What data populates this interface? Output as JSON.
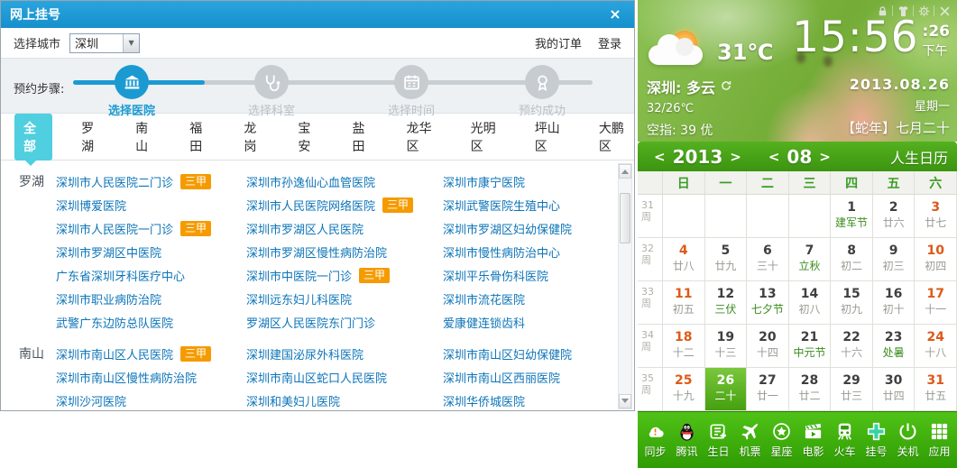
{
  "colors": {
    "titlebar_blue": "#1d9bd7",
    "accent_blue": "#1b9ad2",
    "tab_active_cyan": "#4fcfdf",
    "link_blue": "#0c74b8",
    "badge_orange": "#f59b00",
    "calendar_green": "#3f9e12",
    "weekend_orange": "#dd5a17",
    "toolbar_green": "#3bad0b"
  },
  "window": {
    "title": "网上挂号",
    "close_glyph": "×",
    "city_label": "选择城市",
    "city_value": "深圳",
    "my_orders": "我的订单",
    "login": "登录",
    "steps_label": "预约步骤:",
    "steps": [
      {
        "label": "选择医院",
        "icon": "hospital-building-icon",
        "active": true
      },
      {
        "label": "选择科室",
        "icon": "stethoscope-icon",
        "active": false
      },
      {
        "label": "选择时间",
        "icon": "calendar-icon",
        "active": false
      },
      {
        "label": "预约成功",
        "icon": "award-ribbon-icon",
        "active": false
      }
    ],
    "tabs": [
      "全部",
      "罗湖",
      "南山",
      "福田",
      "龙岗",
      "宝安",
      "盐田",
      "龙华区",
      "光明区",
      "坪山区",
      "大鹏区"
    ],
    "active_tab": "全部",
    "grade_badge": "三甲",
    "groups": [
      {
        "name": "罗湖",
        "columns": [
          [
            {
              "name": "深圳市人民医院二门诊",
              "grade": true
            },
            {
              "name": "深圳博爱医院"
            },
            {
              "name": "深圳市人民医院一门诊",
              "grade": true
            },
            {
              "name": "深圳市罗湖区中医院"
            },
            {
              "name": "广东省深圳牙科医疗中心"
            },
            {
              "name": "深圳市职业病防治院"
            },
            {
              "name": "武警广东边防总队医院"
            }
          ],
          [
            {
              "name": "深圳市孙逸仙心血管医院"
            },
            {
              "name": "深圳市人民医院网络医院",
              "grade": true
            },
            {
              "name": "深圳市罗湖区人民医院"
            },
            {
              "name": "深圳市罗湖区慢性病防治院"
            },
            {
              "name": "深圳市中医院一门诊",
              "grade": true
            },
            {
              "name": "深圳远东妇儿科医院"
            },
            {
              "name": "罗湖区人民医院东门门诊"
            }
          ],
          [
            {
              "name": "深圳市康宁医院"
            },
            {
              "name": "深圳武警医院生殖中心"
            },
            {
              "name": "深圳市罗湖区妇幼保健院"
            },
            {
              "name": "深圳市慢性病防治中心"
            },
            {
              "name": "深圳平乐骨伤科医院"
            },
            {
              "name": "深圳市流花医院"
            },
            {
              "name": "爱康健连锁齿科"
            }
          ]
        ]
      },
      {
        "name": "南山",
        "columns": [
          [
            {
              "name": "深圳市南山区人民医院",
              "grade": true
            },
            {
              "name": "深圳市南山区慢性病防治院"
            },
            {
              "name": "深圳沙河医院"
            }
          ],
          [
            {
              "name": "深圳建国泌尿外科医院"
            },
            {
              "name": "深圳市南山区蛇口人民医院"
            },
            {
              "name": "深圳和美妇儿医院"
            }
          ],
          [
            {
              "name": "深圳市南山区妇幼保健院"
            },
            {
              "name": "深圳市南山区西丽医院"
            },
            {
              "name": "深圳华侨城医院"
            }
          ]
        ]
      }
    ]
  },
  "widget": {
    "window_icons": [
      "lock-icon",
      "skin-shirt-icon",
      "gear-icon",
      "close-icon"
    ],
    "weather": {
      "temp": "31℃",
      "city_line": "深圳: 多云",
      "range": "32/26℃",
      "air": "空指: 39 优"
    },
    "time": {
      "hm": "15:56",
      "sec": ":26",
      "ampm": "下午"
    },
    "date": {
      "date": "2013.08.26",
      "weekday": "星期一",
      "lunar": "【蛇年】七月二十"
    },
    "cal": {
      "prev": "<",
      "next": ">",
      "year": "2013",
      "month": "08",
      "brand": "人生日历",
      "weekdays": [
        "日",
        "一",
        "二",
        "三",
        "四",
        "五",
        "六"
      ],
      "week_suffix": "周",
      "weeks": [
        {
          "num": "31",
          "days": [
            {
              "d": "",
              "l": ""
            },
            {
              "d": "",
              "l": ""
            },
            {
              "d": "",
              "l": ""
            },
            {
              "d": "",
              "l": ""
            },
            {
              "d": "1",
              "l": "建军节",
              "festival": true
            },
            {
              "d": "2",
              "l": "廿六"
            },
            {
              "d": "3",
              "l": "廿七",
              "weekend": true
            }
          ]
        },
        {
          "num": "32",
          "days": [
            {
              "d": "4",
              "l": "廿八",
              "weekend": true
            },
            {
              "d": "5",
              "l": "廿九"
            },
            {
              "d": "6",
              "l": "三十"
            },
            {
              "d": "7",
              "l": "立秋",
              "festival": true
            },
            {
              "d": "8",
              "l": "初二"
            },
            {
              "d": "9",
              "l": "初三"
            },
            {
              "d": "10",
              "l": "初四",
              "weekend": true
            }
          ]
        },
        {
          "num": "33",
          "days": [
            {
              "d": "11",
              "l": "初五",
              "weekend": true
            },
            {
              "d": "12",
              "l": "三伏",
              "festival": true
            },
            {
              "d": "13",
              "l": "七夕节",
              "festival": true
            },
            {
              "d": "14",
              "l": "初八"
            },
            {
              "d": "15",
              "l": "初九"
            },
            {
              "d": "16",
              "l": "初十"
            },
            {
              "d": "17",
              "l": "十一",
              "weekend": true
            }
          ]
        },
        {
          "num": "34",
          "days": [
            {
              "d": "18",
              "l": "十二",
              "weekend": true
            },
            {
              "d": "19",
              "l": "十三"
            },
            {
              "d": "20",
              "l": "十四"
            },
            {
              "d": "21",
              "l": "中元节",
              "festival": true
            },
            {
              "d": "22",
              "l": "十六"
            },
            {
              "d": "23",
              "l": "处暑",
              "festival": true
            },
            {
              "d": "24",
              "l": "十八",
              "weekend": true
            }
          ]
        },
        {
          "num": "35",
          "days": [
            {
              "d": "25",
              "l": "十九",
              "weekend": true
            },
            {
              "d": "26",
              "l": "二十",
              "selected": true
            },
            {
              "d": "27",
              "l": "廿一"
            },
            {
              "d": "28",
              "l": "廿二"
            },
            {
              "d": "29",
              "l": "廿三"
            },
            {
              "d": "30",
              "l": "廿四"
            },
            {
              "d": "31",
              "l": "廿五",
              "weekend": true
            }
          ]
        }
      ]
    },
    "toolbar": [
      {
        "icon": "sync-cloud-icon",
        "label": "同步"
      },
      {
        "icon": "qq-penguin-icon",
        "label": "腾讯"
      },
      {
        "icon": "birthday-calendar-icon",
        "label": "生日"
      },
      {
        "icon": "airplane-icon",
        "label": "机票"
      },
      {
        "icon": "star-circle-icon",
        "label": "星座"
      },
      {
        "icon": "movie-clapper-icon",
        "label": "电影"
      },
      {
        "icon": "train-icon",
        "label": "火车"
      },
      {
        "icon": "medical-cross-icon",
        "label": "挂号"
      },
      {
        "icon": "power-icon",
        "label": "关机"
      },
      {
        "icon": "app-grid-icon",
        "label": "应用"
      }
    ]
  }
}
